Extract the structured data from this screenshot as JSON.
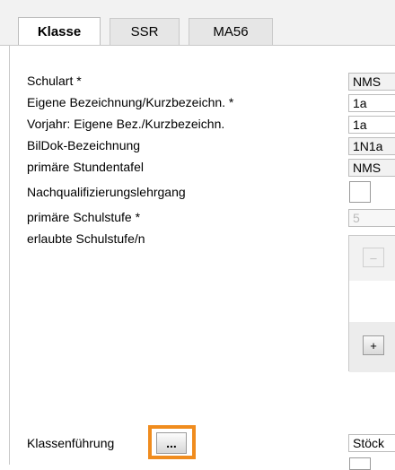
{
  "tabs": [
    {
      "label": "Klasse",
      "active": true
    },
    {
      "label": "SSR",
      "active": false
    },
    {
      "label": "MA56",
      "active": false
    }
  ],
  "form": {
    "schulart": {
      "label": "Schulart *",
      "value": "NMS"
    },
    "eigene_bezeichnung": {
      "label": "Eigene Bezeichnung/Kurzbezeichn. *",
      "value": "1a"
    },
    "vorjahr": {
      "label": "Vorjahr: Eigene Bez./Kurzbezeichn.",
      "value": "1a"
    },
    "bildok": {
      "label": "BilDok-Bezeichnung",
      "value": "1N1a"
    },
    "stundentafel": {
      "label": "primäre Stundentafel",
      "value": "NMS"
    },
    "nachqualifizierung": {
      "label": "Nachqualifizierungslehrgang",
      "checked": false
    },
    "schulstufe": {
      "label": "primäre Schulstufe *",
      "value": "5"
    },
    "erlaubte_schulstufen": {
      "label": "erlaubte Schulstufe/n",
      "remove_label": "–",
      "add_label": "+"
    },
    "klassenfuehrung": {
      "label": "Klassenführung",
      "button_label": "...",
      "value": "Stöck"
    }
  },
  "colors": {
    "highlight": "#f08c1e"
  }
}
